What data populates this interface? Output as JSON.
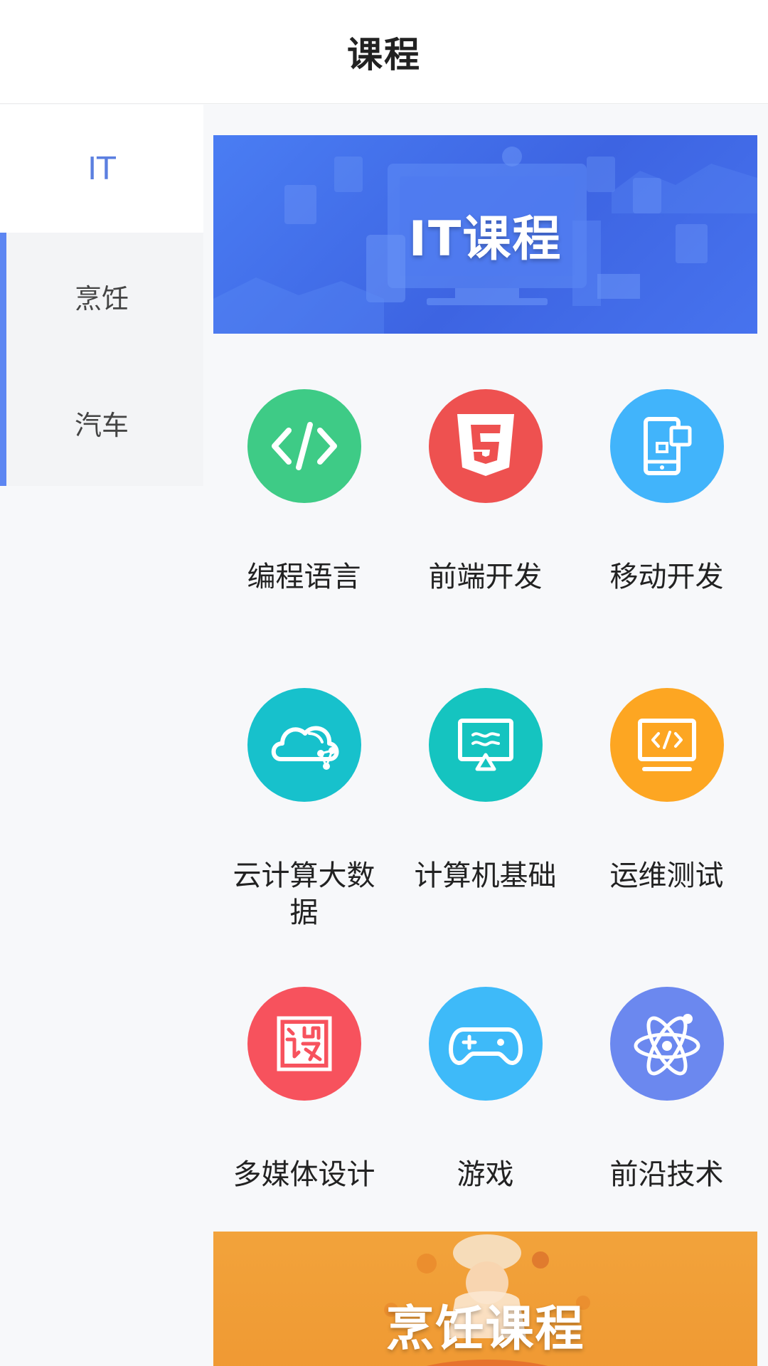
{
  "header": {
    "title": "课程"
  },
  "sidebar": {
    "items": [
      {
        "label": "IT"
      },
      {
        "label": "烹饪"
      },
      {
        "label": "汽车"
      }
    ]
  },
  "banners": {
    "it": "IT课程",
    "cooking": "烹饪课程"
  },
  "categories": [
    {
      "label": "编程语言",
      "icon": "code-icon",
      "color": "#3ecb86"
    },
    {
      "label": "前端开发",
      "icon": "html5-icon",
      "color": "#ee5150"
    },
    {
      "label": "移动开发",
      "icon": "mobile-icon",
      "color": "#41b4fb"
    },
    {
      "label": "云计算大数据",
      "icon": "cloud-icon",
      "color": "#17c1cc"
    },
    {
      "label": "计算机基础",
      "icon": "monitor-icon",
      "color": "#15c4c0"
    },
    {
      "label": "运维测试",
      "icon": "terminal-icon",
      "color": "#fda622"
    },
    {
      "label": "多媒体设计",
      "icon": "design-icon",
      "color": "#f7525d"
    },
    {
      "label": "游戏",
      "icon": "gamepad-icon",
      "color": "#3ebaf9"
    },
    {
      "label": "前沿技术",
      "icon": "atom-icon",
      "color": "#6b88ef"
    }
  ]
}
